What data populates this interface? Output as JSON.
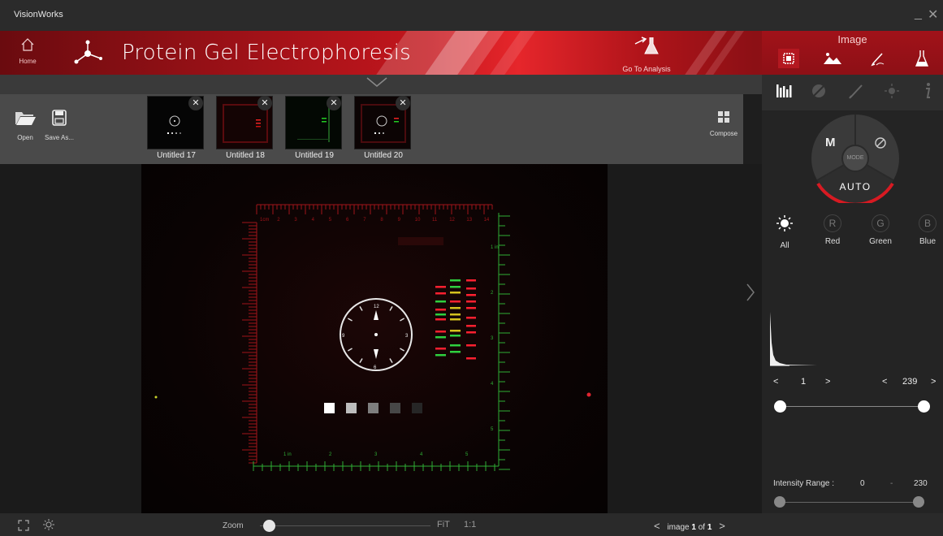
{
  "window": {
    "title": "VisionWorks"
  },
  "header": {
    "home_label": "Home",
    "app_title": "Protein Gel Electrophoresis",
    "go_to_analysis_label": "Go To Analysis",
    "section_label": "Image",
    "section_icons": [
      "chip-icon",
      "landscape-icon",
      "pen-icon",
      "flask-icon"
    ]
  },
  "toolbar": {
    "open_label": "Open",
    "save_as_label": "Save As...",
    "compose_label": "Compose"
  },
  "thumbnails": [
    {
      "label": "Untitled 17"
    },
    {
      "label": "Untitled 18"
    },
    {
      "label": "Untitled 19"
    },
    {
      "label": "Untitled 20"
    }
  ],
  "gel_image": {
    "ruler_top_labels": [
      "1cm",
      "2",
      "3",
      "4",
      "5",
      "6",
      "7",
      "8",
      "9",
      "10",
      "11",
      "12",
      "13",
      "14"
    ],
    "ruler_bottom_labels": [
      "1 in",
      "2",
      "3",
      "4",
      "5"
    ],
    "ruler_right_labels": [
      "1 in",
      "2",
      "3",
      "4",
      "5"
    ],
    "clock_numbers": [
      "12",
      "3",
      "6",
      "9"
    ]
  },
  "right_panel": {
    "tool_icons": [
      "histogram-icon",
      "palette-off-icon",
      "pen-icon",
      "brightness-icon",
      "info-icon"
    ],
    "mode": {
      "manual": "M",
      "center": "MODE",
      "auto": "AUTO"
    },
    "channels": [
      {
        "glyph": "",
        "label": "All"
      },
      {
        "glyph": "R",
        "label": "Red"
      },
      {
        "glyph": "G",
        "label": "Green"
      },
      {
        "glyph": "B",
        "label": "Blue"
      }
    ],
    "range_low": "1",
    "range_high": "239",
    "intensity_label": "Intensity Range :",
    "intensity_min": "0",
    "intensity_sep": "-",
    "intensity_max": "230"
  },
  "bottom": {
    "zoom_label": "Zoom",
    "zoom_value": 0.03,
    "fit_label": "FiT",
    "one_to_one_label": "1:1",
    "page_prefix": "image",
    "page_current": "1",
    "page_of": "of",
    "page_total": "1"
  },
  "colors": {
    "accent_red": "#c2161d",
    "band_green": "#2fd03f",
    "band_red": "#ff2030",
    "ruler_red": "#a0141a",
    "ruler_green": "#2fae35"
  }
}
